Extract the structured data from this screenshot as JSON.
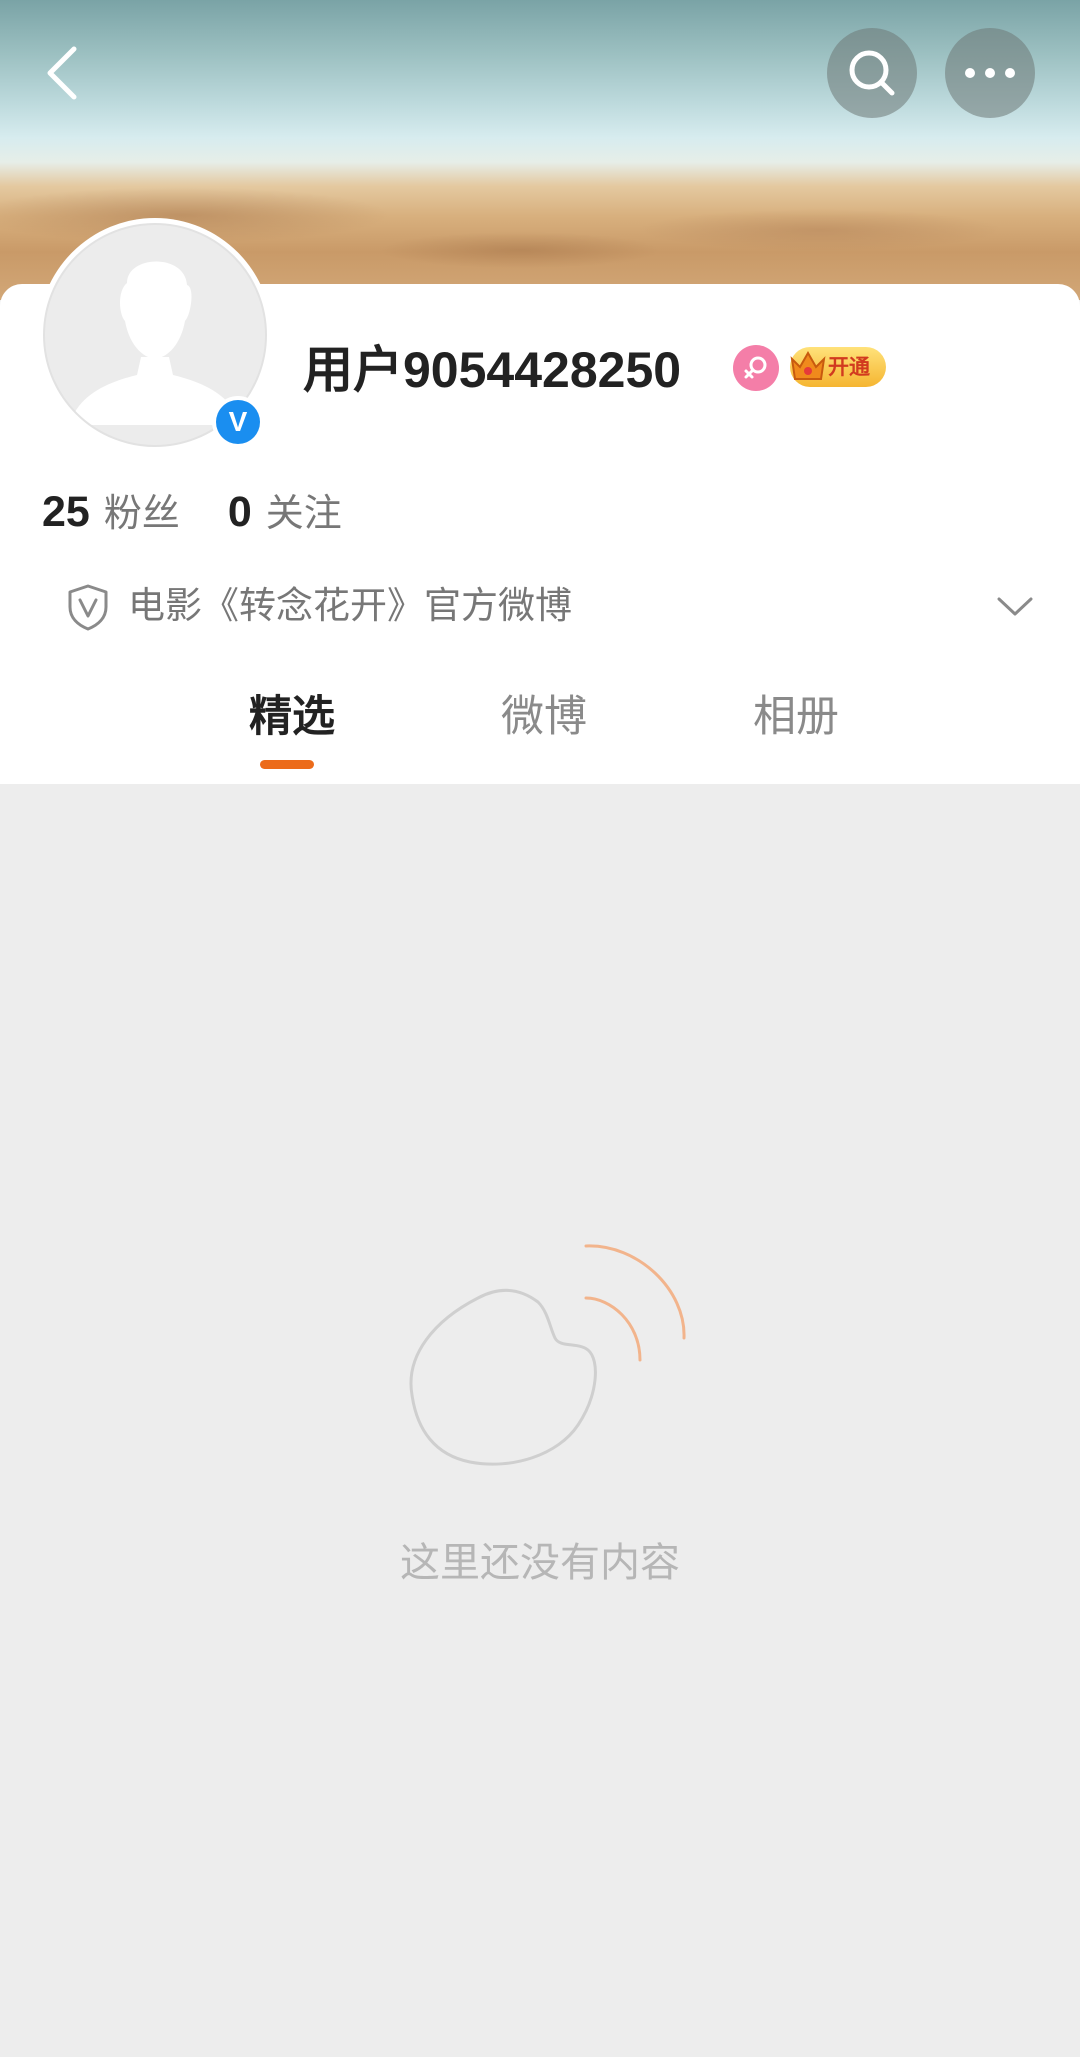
{
  "header": {
    "back_icon": "chevron-left-icon",
    "search_icon": "search-icon",
    "more_icon": "more-horizontal-icon"
  },
  "profile": {
    "username": "用户9054428250",
    "gender_icon": "female-icon",
    "verified_icon": "verified-v-icon",
    "verified_badge_letter": "V",
    "vip_badge_label": "开通",
    "stats": [
      {
        "count": "25",
        "label": "粉丝"
      },
      {
        "count": "0",
        "label": "关注"
      }
    ],
    "description": "电影《转念花开》官方微博"
  },
  "tabs": [
    {
      "label": "精选",
      "active": true
    },
    {
      "label": "微博",
      "active": false
    },
    {
      "label": "相册",
      "active": false
    }
  ],
  "empty_state": {
    "message": "这里还没有内容"
  },
  "colors": {
    "accent": "#ec6b1a",
    "verified_blue": "#1a8ef0",
    "gender_pink": "#f47ea8",
    "page_bg": "#ededed"
  }
}
